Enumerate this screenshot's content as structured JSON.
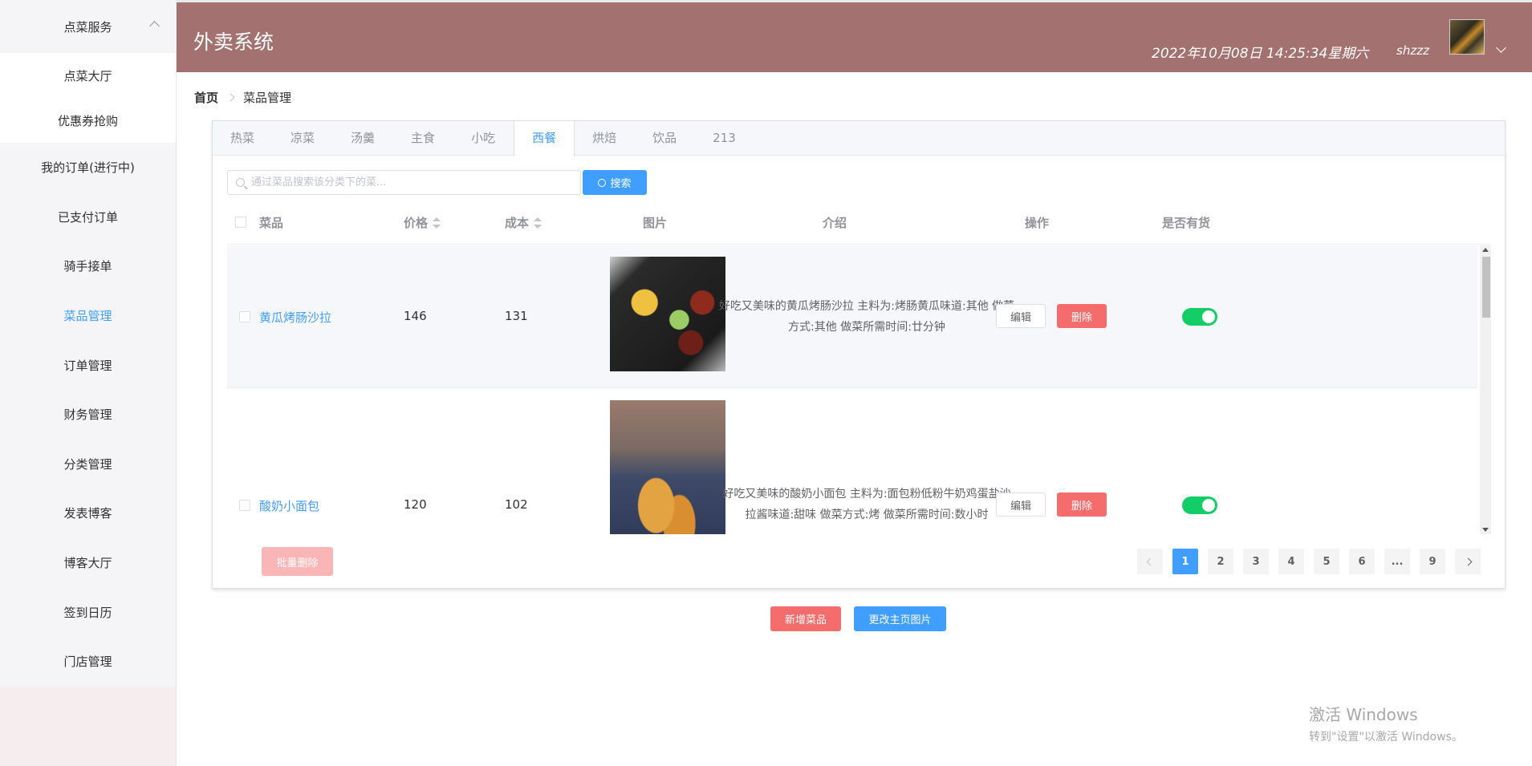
{
  "sidebar": {
    "group_label": "点菜服务",
    "sub_items": [
      "点菜大厅",
      "优惠券抢购"
    ],
    "items": [
      "我的订单(进行中)",
      "已支付订单",
      "骑手接单",
      "菜品管理",
      "订单管理",
      "财务管理",
      "分类管理",
      "发表博客",
      "博客大厅",
      "签到日历",
      "门店管理"
    ],
    "active_item": "菜品管理"
  },
  "header": {
    "title": "外卖系统",
    "datetime": "2022年10月08日 14:25:34星期六",
    "username": "shzzz"
  },
  "breadcrumb": {
    "home": "首页",
    "current": "菜品管理"
  },
  "tabs": [
    "热菜",
    "凉菜",
    "汤羹",
    "主食",
    "小吃",
    "西餐",
    "烘焙",
    "饮品",
    "213"
  ],
  "active_tab": "西餐",
  "search": {
    "placeholder": "通过菜品搜索该分类下的菜...",
    "button_label": "搜索"
  },
  "table": {
    "columns": {
      "dish": "菜品",
      "price": "价格",
      "cost": "成本",
      "image": "图片",
      "intro": "介绍",
      "actions": "操作",
      "in_stock": "是否有货"
    },
    "rows": [
      {
        "name": "黄瓜烤肠沙拉",
        "price": "146",
        "cost": "131",
        "intro": "好吃又美味的黄瓜烤肠沙拉 主料为:烤肠黄瓜味道:其他 做菜方式:其他 做菜所需时间:廿分钟",
        "edit": "编辑",
        "delete": "删除",
        "in_stock": true
      },
      {
        "name": "酸奶小面包",
        "price": "120",
        "cost": "102",
        "intro": "好吃又美味的酸奶小面包 主料为:面包粉低粉牛奶鸡蛋盐沙拉酱味道:甜味 做菜方式:烤 做菜所需时间:数小时",
        "edit": "编辑",
        "delete": "删除",
        "in_stock": true
      }
    ]
  },
  "batch_delete_label": "批量删除",
  "pagination": {
    "pages": [
      "1",
      "2",
      "3",
      "4",
      "5",
      "6",
      "...",
      "9"
    ],
    "current": "1"
  },
  "actions": {
    "add_dish": "新增菜品",
    "change_home_image": "更改主页图片"
  },
  "watermark": {
    "line1": "激活 Windows",
    "line2": "转到\"设置\"以激活 Windows。"
  }
}
